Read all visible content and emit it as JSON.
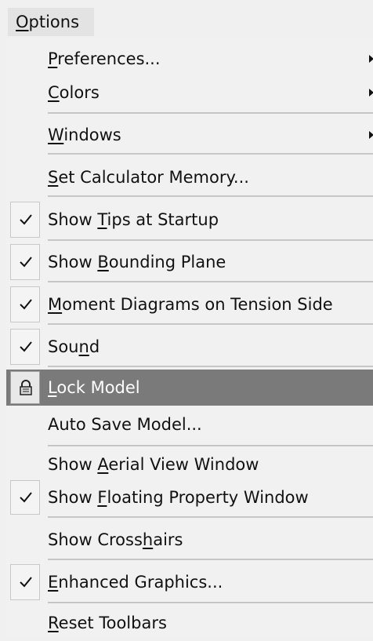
{
  "menu": {
    "title": "Options",
    "title_mnemonic": "O",
    "items": [
      {
        "label": "Preferences...",
        "mnemonic_index": 0,
        "submenu": true,
        "checked": false
      },
      {
        "label": "Colors",
        "mnemonic_index": 0,
        "submenu": true,
        "checked": false
      },
      {
        "label": "Windows",
        "mnemonic_index": 0,
        "submenu": true,
        "checked": false
      },
      {
        "label": "Set Calculator Memory...",
        "mnemonic_index": 0,
        "submenu": false,
        "checked": false
      },
      {
        "label": "Show Tips at Startup",
        "mnemonic_index": 5,
        "submenu": false,
        "checked": true
      },
      {
        "label": "Show Bounding Plane",
        "mnemonic_index": 5,
        "submenu": false,
        "checked": true
      },
      {
        "label": "Moment Diagrams on Tension Side",
        "mnemonic_index": 0,
        "submenu": false,
        "checked": true
      },
      {
        "label": "Sound",
        "mnemonic_index": 3,
        "submenu": false,
        "checked": true
      },
      {
        "label": "Lock Model",
        "mnemonic_index": 0,
        "submenu": false,
        "checked": false,
        "icon": "lock-icon",
        "highlighted": true
      },
      {
        "label": "Auto Save Model...",
        "mnemonic_index": -1,
        "submenu": false,
        "checked": false
      },
      {
        "label": "Show Aerial View Window",
        "mnemonic_index": 5,
        "submenu": false,
        "checked": false
      },
      {
        "label": "Show Floating Property Window",
        "mnemonic_index": 5,
        "submenu": false,
        "checked": true
      },
      {
        "label": "Show Crosshairs",
        "mnemonic_index": 10,
        "submenu": false,
        "checked": false
      },
      {
        "label": "Enhanced Graphics...",
        "mnemonic_index": 0,
        "submenu": false,
        "checked": true
      },
      {
        "label": "Reset Toolbars",
        "mnemonic_index": 0,
        "submenu": false,
        "checked": false
      }
    ]
  },
  "colors": {
    "background": "#f0f0f0",
    "highlight": "#7a7a7a",
    "highlight_text": "#ffffff",
    "separator": "#c6c6c6"
  }
}
